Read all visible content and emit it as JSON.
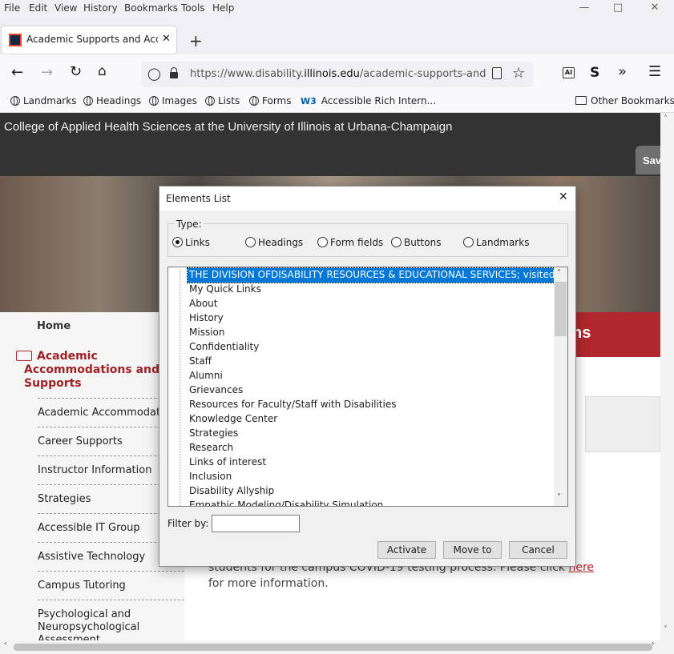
{
  "menubar": {
    "items": [
      "File",
      "Edit",
      "View",
      "History",
      "Bookmarks",
      "Tools",
      "Help"
    ]
  },
  "tab": {
    "title": "Academic Supports and Accom"
  },
  "address": {
    "prefix": "https://www.disability.",
    "domain": "illinois.edu",
    "path": "/academic-supports-and-ac"
  },
  "bookmarks": {
    "items": [
      "Landmarks",
      "Headings",
      "Images",
      "Lists",
      "Forms",
      "Accessible Rich Intern..."
    ],
    "other": "Other Bookmarks"
  },
  "site": {
    "college": "College of Applied Health Sciences at the University of Illinois at Urbana-Champaign",
    "save_btn": "Sav",
    "banner_fragment": "ns",
    "home": "Home",
    "section": "Academic Accommodations and Supports",
    "sidebar_links": [
      "Academic Accommodation",
      "Career Supports",
      "Instructor Information",
      "Strategies",
      "Accessible IT Group",
      "Assistive Technology",
      "Campus Tutoring",
      "Psychological and Neuropsychological Assessment"
    ],
    "body_line1_text": "students for the campus COVID-19 testing process.  Please click ",
    "body_link": "here",
    "body_line2": "for more information."
  },
  "dialog": {
    "title": "Elements List",
    "type_label": "Type:",
    "types": [
      "Links",
      "Headings",
      "Form fields",
      "Buttons",
      "Landmarks"
    ],
    "selected_type": "Links",
    "items": [
      "THE DIVISION OFDISABILITY RESOURCES & EDUCATIONAL SERVICES; visited",
      "My Quick Links",
      "About",
      "History",
      "Mission",
      "Confidentiality",
      "Staff",
      "Alumni",
      "Grievances",
      "Resources for Faculty/Staff with Disabilities",
      "Knowledge Center",
      "Strategies",
      "Research",
      "Links of interest",
      "Inclusion",
      "Disability Allyship",
      "Empathic Modeling/Disability Simulation"
    ],
    "filter_label": "Filter by:",
    "filter_value": "",
    "buttons": [
      "Activate",
      "Move to",
      "Cancel"
    ]
  }
}
